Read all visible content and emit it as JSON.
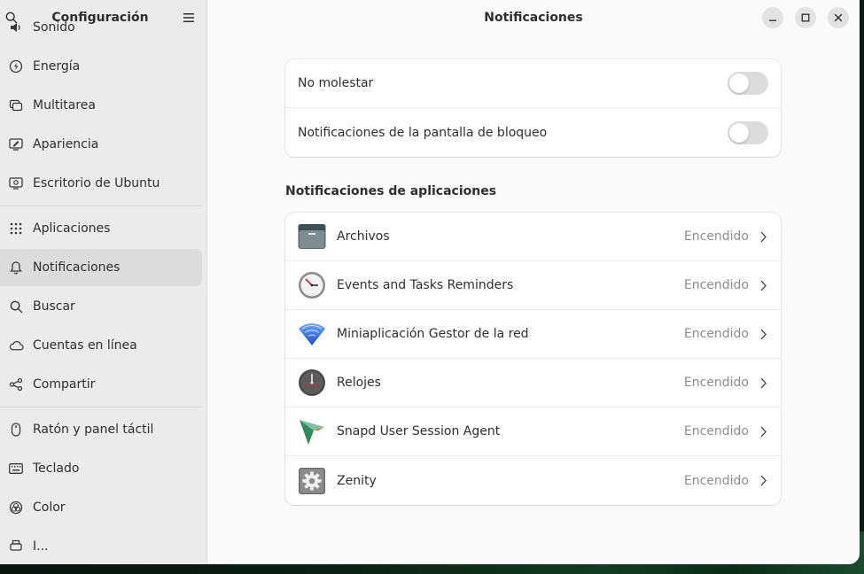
{
  "sidebar": {
    "title": "Configuración",
    "items": [
      {
        "label": "Sonido",
        "icon": "speaker-icon"
      },
      {
        "label": "Energía",
        "icon": "power-icon"
      },
      {
        "label": "Multitarea",
        "icon": "multitask-icon"
      },
      {
        "label": "Apariencia",
        "icon": "appearance-icon"
      },
      {
        "label": "Escritorio de Ubuntu",
        "icon": "ubuntu-desktop-icon"
      },
      {
        "label": "Aplicaciones",
        "icon": "apps-grid-icon"
      },
      {
        "label": "Notificaciones",
        "icon": "bell-icon"
      },
      {
        "label": "Buscar",
        "icon": "search-icon"
      },
      {
        "label": "Cuentas en línea",
        "icon": "cloud-icon"
      },
      {
        "label": "Compartir",
        "icon": "share-icon"
      },
      {
        "label": "Ratón y panel táctil",
        "icon": "mouse-icon"
      },
      {
        "label": "Teclado",
        "icon": "keyboard-icon"
      },
      {
        "label": "Color",
        "icon": "color-icon"
      },
      {
        "label": "I...",
        "icon": "printer-icon"
      }
    ]
  },
  "main": {
    "title": "Notificaciones",
    "toggles": [
      {
        "label": "No molestar",
        "on": false
      },
      {
        "label": "Notificaciones de la pantalla de bloqueo",
        "on": false
      }
    ],
    "section_title": "Notificaciones de aplicaciones",
    "apps": [
      {
        "name": "Archivos",
        "status": "Encendido",
        "icon": "files-icon"
      },
      {
        "name": "Events and Tasks Reminders",
        "status": "Encendido",
        "icon": "clock-reminder-icon"
      },
      {
        "name": "Miniaplicación Gestor de la red",
        "status": "Encendido",
        "icon": "network-wifi-icon"
      },
      {
        "name": "Relojes",
        "status": "Encendido",
        "icon": "clocks-icon"
      },
      {
        "name": "Snapd User Session Agent",
        "status": "Encendido",
        "icon": "snapd-icon"
      },
      {
        "name": "Zenity",
        "status": "Encendido",
        "icon": "zenity-gear-icon"
      }
    ]
  },
  "colors": {
    "sidebar_bg": "#ebebeb",
    "selected_bg": "#dcdcdc",
    "main_bg": "#fafafa",
    "status_text": "#8c8c8c"
  }
}
